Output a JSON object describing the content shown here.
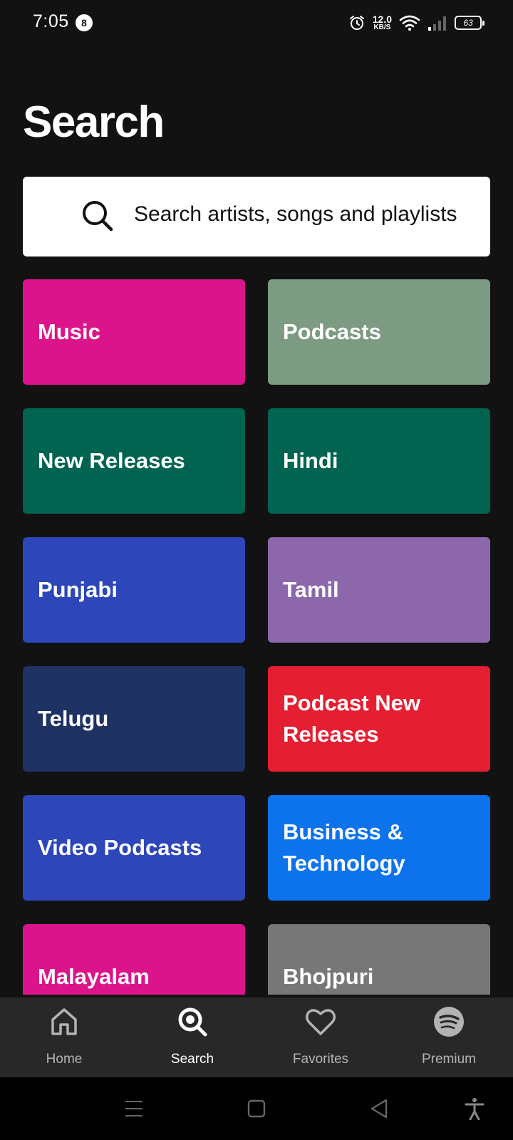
{
  "status_bar": {
    "time": "7:05",
    "notification_count": "8",
    "net_speed_value": "12.0",
    "net_speed_unit": "KB/S",
    "battery_level": "63",
    "icons": [
      "alarm-icon",
      "wifi-icon",
      "cell-signal-icon",
      "battery-icon"
    ]
  },
  "page": {
    "title": "Search"
  },
  "search": {
    "placeholder": "Search artists, songs and playlists",
    "icon": "search-icon"
  },
  "categories": [
    {
      "label": "Music",
      "color": "#dc148c"
    },
    {
      "label": "Podcasts",
      "color": "#7d9a82"
    },
    {
      "label": "New Releases",
      "color": "#006450"
    },
    {
      "label": "Hindi",
      "color": "#006450"
    },
    {
      "label": "Punjabi",
      "color": "#2d46b9"
    },
    {
      "label": "Tamil",
      "color": "#8d67ab"
    },
    {
      "label": "Telugu",
      "color": "#1e3264"
    },
    {
      "label": "Podcast New Releases",
      "color": "#e61e32"
    },
    {
      "label": "Video Podcasts",
      "color": "#2d46b9"
    },
    {
      "label": "Business & Technology",
      "color": "#0d73ec"
    },
    {
      "label": "Malayalam",
      "color": "#dc148c"
    },
    {
      "label": "Bhojpuri",
      "color": "#777777"
    }
  ],
  "bottom_nav": {
    "items": [
      {
        "label": "Home",
        "icon": "home-icon",
        "active": false
      },
      {
        "label": "Search",
        "icon": "search-icon",
        "active": true
      },
      {
        "label": "Favorites",
        "icon": "heart-icon",
        "active": false
      },
      {
        "label": "Premium",
        "icon": "spotify-logo-icon",
        "active": false
      }
    ]
  },
  "colors": {
    "background": "#121212",
    "nav_background": "#282828",
    "active_text": "#ffffff",
    "inactive_text": "#b3b3b3"
  }
}
